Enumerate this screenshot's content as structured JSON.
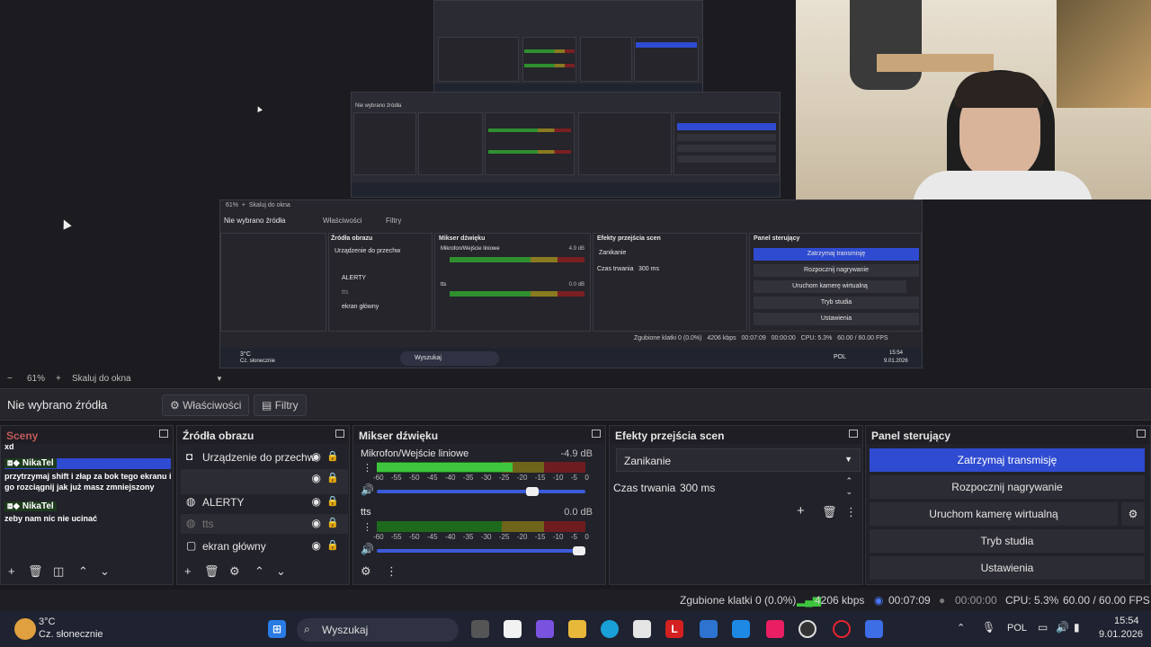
{
  "preview": {
    "nested_zoom": "61%",
    "nested_fit": "Skaluj do okna",
    "nested_no_source": "Nie wybrano źródła",
    "nested_properties": "Właściwości",
    "nested_filters": "Filtry",
    "nested_sources_title": "Źródła obrazu",
    "nested_mixer_title": "Mikser dźwięku",
    "nested_transitions_title": "Efekty przejścia scen",
    "nested_controls_title": "Panel sterujący",
    "nested_mic": "Mikrofon/Wejście liniowe",
    "nested_mic_db": "4.9 dB",
    "nested_tts": "tts",
    "nested_tts_db": "0.0 dB",
    "nested_transition": "Zanikanie",
    "nested_duration_label": "Czas trwania",
    "nested_duration": "300 ms",
    "nested_stop": "Zatrzymaj transmisję",
    "nested_record": "Rozpocznij nagrywanie",
    "nested_vcam": "Uruchom kamerę wirtualną",
    "nested_studio": "Tryb studia",
    "nested_settings": "Ustawienia",
    "nested_src_device": "Urządzenie do przechw",
    "nested_src_alerts": "ALERTY",
    "nested_src_tts": "tts",
    "nested_src_screen": "ekran główny",
    "nested_status_dropped": "Zgubione klatki 0 (0.0%)",
    "nested_status_kbps": "4206 kbps",
    "nested_status_time": "00:07:09",
    "nested_status_rec": "00:00:00",
    "nested_status_cpu": "CPU: 5.3%",
    "nested_status_fps": "60.00 / 60.00 FPS",
    "nested_weather_temp": "3°C",
    "nested_weather_desc": "Cz. słonecznie",
    "nested_search": "Wyszukaj",
    "nested_lang": "POL",
    "nested_clock_time": "15:54",
    "nested_clock_date": "9.01.2026"
  },
  "zoombar": {
    "minus": "−",
    "zoom": "61%",
    "plus": "+",
    "fit": "Skaluj do okna"
  },
  "propbar": {
    "no_source": "Nie wybrano źródła",
    "properties": "Właściwości",
    "filters": "Filtry"
  },
  "scenes": {
    "title": "Sceny",
    "chat": [
      {
        "text": "xd"
      },
      {
        "user": "NikaTel",
        "text": "przytrzymaj shift i złap za bok tego ekranu i go rozciągnij jak już masz zmniejszony"
      },
      {
        "user": "NikaTel",
        "text": "zeby nam nic nie ucinać"
      }
    ]
  },
  "sources": {
    "title": "Źródła obrazu",
    "items": [
      {
        "icon": "camera-icon",
        "name": "Urządzenie do przechw"
      },
      {
        "icon": "globe-icon",
        "name": "ALERTY"
      },
      {
        "icon": "globe-icon",
        "name": "tts"
      },
      {
        "icon": "monitor-icon",
        "name": "ekran główny"
      }
    ]
  },
  "mixer": {
    "title": "Mikser dźwięku",
    "channels": [
      {
        "name": "Mikrofon/Wejście liniowe",
        "db": "-4.9 dB",
        "level_fraction": 0.65
      },
      {
        "name": "tts",
        "db": "0.0 dB",
        "level_fraction": 0.0
      }
    ],
    "scale": [
      "-60",
      "-55",
      "-50",
      "-45",
      "-40",
      "-35",
      "-30",
      "-25",
      "-20",
      "-15",
      "-10",
      "-5",
      "0"
    ],
    "mic_volume_fraction": 0.76,
    "tts_volume_fraction": 1.0
  },
  "transitions": {
    "title": "Efekty przejścia scen",
    "selected": "Zanikanie",
    "duration_label": "Czas trwania",
    "duration": "300 ms"
  },
  "controls": {
    "title": "Panel sterujący",
    "stop_stream": "Zatrzymaj transmisję",
    "start_recording": "Rozpocznij nagrywanie",
    "virtual_camera": "Uruchom kamerę wirtualną",
    "studio_mode": "Tryb studia",
    "settings": "Ustawienia"
  },
  "status": {
    "dropped": "Zgubione klatki 0 (0.0%)",
    "kbps": "4206 kbps",
    "stream_time": "00:07:09",
    "rec_time": "00:00:00",
    "cpu": "CPU: 5.3%",
    "fps": "60.00 / 60.00 FPS"
  },
  "taskbar": {
    "weather_temp": "3°C",
    "weather_desc": "Cz. słonecznie",
    "search": "Wyszukaj",
    "lang": "POL",
    "time": "15:54",
    "date": "9.01.2026"
  },
  "colors": {
    "accent": "#2f4bd1",
    "meter_green": "#3ec63e",
    "bg": "#1a1a1e"
  }
}
